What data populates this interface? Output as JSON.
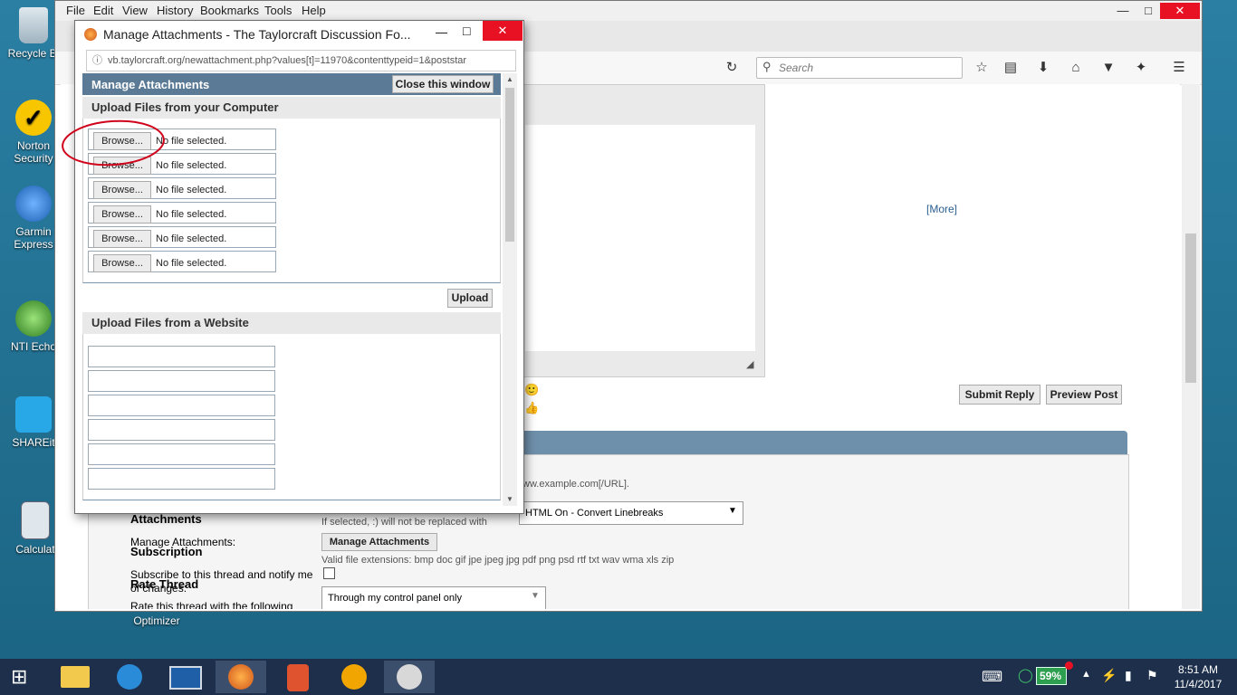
{
  "desktop": {
    "icons": [
      {
        "label": "Recycle Bi",
        "icon": "recycle-bin-icon"
      },
      {
        "label": "Norton Security",
        "icon": "norton-icon"
      },
      {
        "label": "Garmin Express",
        "icon": "garmin-icon"
      },
      {
        "label": "NTI Echo",
        "icon": "nti-echo-icon"
      },
      {
        "label": "SHAREit",
        "icon": "shareit-icon"
      },
      {
        "label": "Calculat",
        "icon": "calculator-icon"
      },
      {
        "label": "Optimizer",
        "icon": "optimizer-icon"
      }
    ]
  },
  "browser": {
    "menu": [
      "File",
      "Edit",
      "View",
      "History",
      "Bookmarks",
      "Tools",
      "Help"
    ],
    "search_placeholder": "Search",
    "page": {
      "more_link": "[More]",
      "submit_reply": "Submit Reply",
      "preview_post": "Preview Post",
      "url_hint": "ww.example.com[/URL].",
      "attachments_label": "Attachments",
      "smilies_note": "If selected, :) will not be replaced with",
      "html_select": "HTML On - Convert Linebreaks",
      "manage_attachments_label": "Manage Attachments:",
      "manage_attachments_button": "Manage Attachments",
      "subscription_label": "Subscription",
      "valid_ext": "Valid file extensions: bmp doc gif jpe jpeg jpg pdf png psd rtf txt wav wma xls zip",
      "subscribe_label": "Subscribe to this thread and notify me of changes:",
      "subscribe_select": "Through my control panel only",
      "rate_thread_label": "Rate Thread",
      "rate_thread_desc": "Rate this thread with the following"
    }
  },
  "popup": {
    "title": "Manage Attachments - The Taylorcraft Discussion Fo...",
    "url": "vb.taylorcraft.org/newattachment.php?values[t]=11970&contenttypeid=1&poststar",
    "header": "Manage Attachments",
    "close_button": "Close this window",
    "upload_computer_heading": "Upload Files from your Computer",
    "browse_label": "Browse...",
    "no_file_label": "No file selected.",
    "file_rows": 6,
    "upload_button": "Upload",
    "upload_website_heading": "Upload Files from a Website"
  },
  "taskbar": {
    "battery": "59%",
    "time": "8:51 AM",
    "date": "11/4/2017"
  },
  "colors": {
    "popup_header": "#5b7a96",
    "close_red": "#e81123",
    "annotation_red": "#d0021b",
    "taskbar": "#1d2f4a"
  }
}
